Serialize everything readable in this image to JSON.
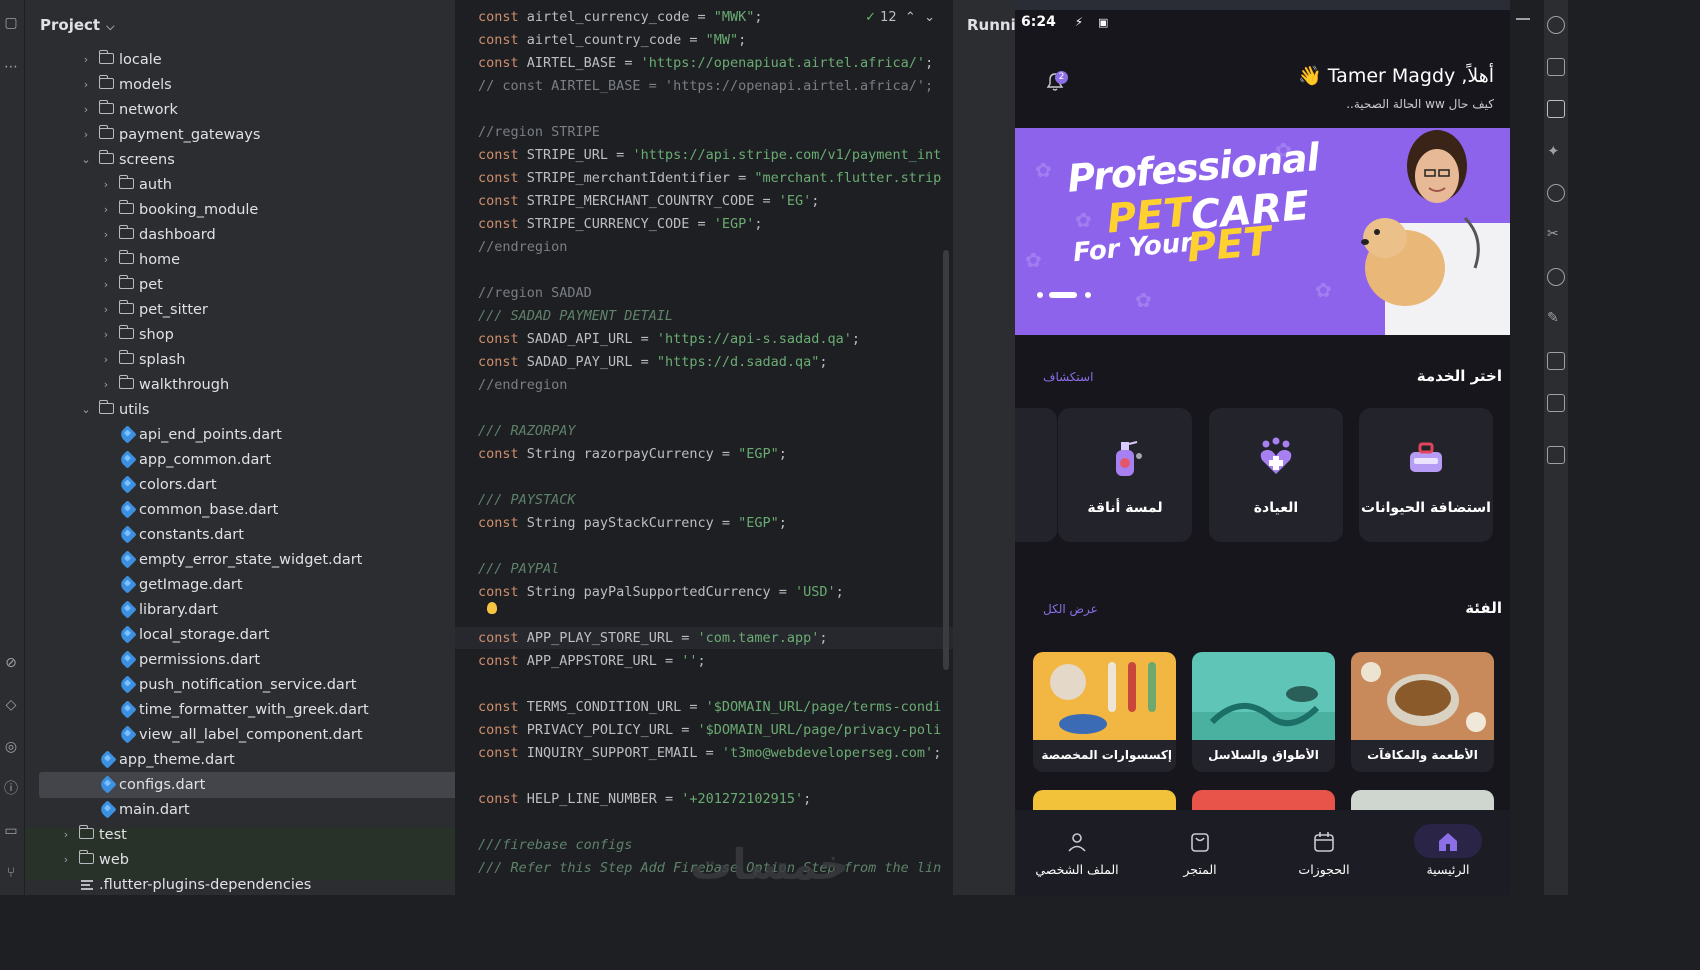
{
  "ide": {
    "project_title": "Project",
    "run_title": "Running",
    "inspection_count": "12"
  },
  "tree": [
    {
      "label": "locale",
      "type": "folder",
      "depth": 2,
      "expanded": false
    },
    {
      "label": "models",
      "type": "folder",
      "depth": 2,
      "expanded": false
    },
    {
      "label": "network",
      "type": "folder",
      "depth": 2,
      "expanded": false
    },
    {
      "label": "payment_gateways",
      "type": "folder",
      "depth": 2,
      "expanded": false
    },
    {
      "label": "screens",
      "type": "folder",
      "depth": 2,
      "expanded": true
    },
    {
      "label": "auth",
      "type": "folder",
      "depth": 3,
      "expanded": false
    },
    {
      "label": "booking_module",
      "type": "folder",
      "depth": 3,
      "expanded": false
    },
    {
      "label": "dashboard",
      "type": "folder",
      "depth": 3,
      "expanded": false
    },
    {
      "label": "home",
      "type": "folder",
      "depth": 3,
      "expanded": false
    },
    {
      "label": "pet",
      "type": "folder",
      "depth": 3,
      "expanded": false
    },
    {
      "label": "pet_sitter",
      "type": "folder",
      "depth": 3,
      "expanded": false
    },
    {
      "label": "shop",
      "type": "folder",
      "depth": 3,
      "expanded": false
    },
    {
      "label": "splash",
      "type": "folder",
      "depth": 3,
      "expanded": false
    },
    {
      "label": "walkthrough",
      "type": "folder",
      "depth": 3,
      "expanded": false
    },
    {
      "label": "utils",
      "type": "folder",
      "depth": 2,
      "expanded": true
    },
    {
      "label": "api_end_points.dart",
      "type": "dart",
      "depth": 3
    },
    {
      "label": "app_common.dart",
      "type": "dart",
      "depth": 3
    },
    {
      "label": "colors.dart",
      "type": "dart",
      "depth": 3
    },
    {
      "label": "common_base.dart",
      "type": "dart",
      "depth": 3
    },
    {
      "label": "constants.dart",
      "type": "dart",
      "depth": 3
    },
    {
      "label": "empty_error_state_widget.dart",
      "type": "dart",
      "depth": 3
    },
    {
      "label": "getImage.dart",
      "type": "dart",
      "depth": 3
    },
    {
      "label": "library.dart",
      "type": "dart",
      "depth": 3
    },
    {
      "label": "local_storage.dart",
      "type": "dart",
      "depth": 3
    },
    {
      "label": "permissions.dart",
      "type": "dart",
      "depth": 3
    },
    {
      "label": "push_notification_service.dart",
      "type": "dart",
      "depth": 3
    },
    {
      "label": "time_formatter_with_greek.dart",
      "type": "dart",
      "depth": 3
    },
    {
      "label": "view_all_label_component.dart",
      "type": "dart",
      "depth": 3
    },
    {
      "label": "app_theme.dart",
      "type": "dart",
      "depth": 2
    },
    {
      "label": "configs.dart",
      "type": "dart",
      "depth": 2,
      "selected": true
    },
    {
      "label": "main.dart",
      "type": "dart",
      "depth": 2
    },
    {
      "label": "test",
      "type": "folder",
      "depth": 1,
      "expanded": false
    },
    {
      "label": "web",
      "type": "folder",
      "depth": 1,
      "expanded": false
    },
    {
      "label": ".flutter-plugins-dependencies",
      "type": "file",
      "depth": 1
    }
  ],
  "code": [
    [
      [
        "kw",
        "const "
      ],
      [
        "",
        "airtel_currency_code = "
      ],
      [
        "str",
        "\"MWK\""
      ],
      [
        "",
        ";"
      ]
    ],
    [
      [
        "kw",
        "const "
      ],
      [
        "",
        "airtel_country_code = "
      ],
      [
        "str",
        "\"MW\""
      ],
      [
        "",
        ";"
      ]
    ],
    [
      [
        "kw",
        "const "
      ],
      [
        "",
        "AIRTEL_BASE = "
      ],
      [
        "str",
        "'https://openapiuat.airtel.africa/'"
      ],
      [
        "",
        ";"
      ]
    ],
    [
      [
        "cm",
        "// const AIRTEL_BASE = 'https://openapi.airtel.africa/';"
      ]
    ],
    [],
    [
      [
        "cm",
        "//region STRIPE"
      ]
    ],
    [
      [
        "kw",
        "const "
      ],
      [
        "",
        "STRIPE_URL = "
      ],
      [
        "str",
        "'https://api.stripe.com/v1/payment_int"
      ]
    ],
    [
      [
        "kw",
        "const "
      ],
      [
        "",
        "STRIPE_merchantIdentifier = "
      ],
      [
        "str",
        "\"merchant.flutter.strip"
      ]
    ],
    [
      [
        "kw",
        "const "
      ],
      [
        "",
        "STRIPE_MERCHANT_COUNTRY_CODE = "
      ],
      [
        "str",
        "'EG'"
      ],
      [
        "",
        ";"
      ]
    ],
    [
      [
        "kw",
        "const "
      ],
      [
        "",
        "STRIPE_CURRENCY_CODE = "
      ],
      [
        "str",
        "'EGP'"
      ],
      [
        "",
        ";"
      ]
    ],
    [
      [
        "cm",
        "//endregion"
      ]
    ],
    [],
    [
      [
        "cm",
        "//region SADAD"
      ]
    ],
    [
      [
        "doc",
        "/// SADAD PAYMENT DETAIL"
      ]
    ],
    [
      [
        "kw",
        "const "
      ],
      [
        "",
        "SADAD_API_URL = "
      ],
      [
        "str",
        "'https://api-s.sadad.qa'"
      ],
      [
        "",
        ";"
      ]
    ],
    [
      [
        "kw",
        "const "
      ],
      [
        "",
        "SADAD_PAY_URL = "
      ],
      [
        "str",
        "\"https://d.sadad.qa\""
      ],
      [
        "",
        ";"
      ]
    ],
    [
      [
        "cm",
        "//endregion"
      ]
    ],
    [],
    [
      [
        "doc",
        "/// RAZORPAY"
      ]
    ],
    [
      [
        "kw",
        "const "
      ],
      [
        "",
        "String razorpayCurrency = "
      ],
      [
        "str",
        "\"EGP\""
      ],
      [
        "",
        ";"
      ]
    ],
    [],
    [
      [
        "doc",
        "/// PAYSTACK"
      ]
    ],
    [
      [
        "kw",
        "const "
      ],
      [
        "",
        "String payStackCurrency = "
      ],
      [
        "str",
        "\"EGP\""
      ],
      [
        "",
        ";"
      ]
    ],
    [],
    [
      [
        "doc",
        "/// PAYPAl"
      ]
    ],
    [
      [
        "kw",
        "const "
      ],
      [
        "",
        "String payPalSupportedCurrency = "
      ],
      [
        "str",
        "'USD'"
      ],
      [
        "",
        ";"
      ]
    ],
    [],
    [
      [
        "kw",
        "const "
      ],
      [
        "",
        "APP_PLAY_STORE_URL = "
      ],
      [
        "str",
        "'com.tamer.app'"
      ],
      [
        "",
        ";"
      ]
    ],
    [
      [
        "kw",
        "const "
      ],
      [
        "",
        "APP_APPSTORE_URL = "
      ],
      [
        "str",
        "''"
      ],
      [
        "",
        ";"
      ]
    ],
    [],
    [
      [
        "kw",
        "const "
      ],
      [
        "",
        "TERMS_CONDITION_URL = "
      ],
      [
        "str",
        "'$DOMAIN_URL/page/terms-condi"
      ]
    ],
    [
      [
        "kw",
        "const "
      ],
      [
        "",
        "PRIVACY_POLICY_URL = "
      ],
      [
        "str",
        "'$DOMAIN_URL/page/privacy-poli"
      ]
    ],
    [
      [
        "kw",
        "const "
      ],
      [
        "",
        "INQUIRY_SUPPORT_EMAIL = "
      ],
      [
        "str",
        "'t3mo@webdeveloperseg.com'"
      ],
      [
        "",
        ";"
      ]
    ],
    [],
    [
      [
        "kw",
        "const "
      ],
      [
        "",
        "HELP_LINE_NUMBER = "
      ],
      [
        "str",
        "'+201272102915'"
      ],
      [
        "",
        ";"
      ]
    ],
    [],
    [
      [
        "doc",
        "///firebase configs"
      ]
    ],
    [
      [
        "doc",
        "/// Refer this Step Add Firebase Option Step from the lin"
      ]
    ]
  ],
  "phone": {
    "time": "6:24",
    "greeting": "أهلاً, Tamer Magdy 👋",
    "greeting_sub": "كيف حال ww الحالة الصحية..",
    "notif_count": "2",
    "banner": {
      "line1": "Professional",
      "line2a": "PET",
      "line2b": "CARE",
      "line3a": "For Your",
      "line3b": "PET"
    },
    "services_title": "اختر الخدمة",
    "services_link": "استكشاف",
    "services": [
      "استضافة الحيوانات",
      "العيادة",
      "لمسة أناقة"
    ],
    "categories_title": "الفئة",
    "categories_link": "عرض الكل",
    "categories": [
      "الأطعمة والمكافآت",
      "الأطواق والسلاسل",
      "إكسسوارات المخصصة و..."
    ],
    "nav": [
      "الرئيسية",
      "الحجوزات",
      "المتجر",
      "الملف الشخصي"
    ]
  },
  "watermark": "خمسات",
  "colors": {
    "accent": "#8c6ee6",
    "banner_purple": "#8e63ec",
    "banner_yellow": "#ffd12e",
    "keyword": "#cf8e6d",
    "string": "#6aab73"
  }
}
